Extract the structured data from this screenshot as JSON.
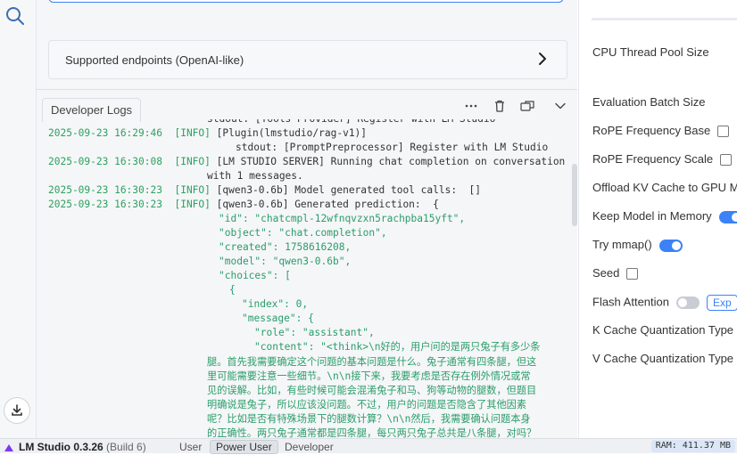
{
  "endpoint": {
    "label": "Supported endpoints (OpenAI-like)"
  },
  "logs_panel": {
    "tab_label": "Developer Logs"
  },
  "log_lines": {
    "l0": "stdout: [Tools Provider] Register with LM Studio",
    "l1_ts": "2025-09-23 16:29:46",
    "l1_lvl": "[INFO]",
    "l1_msg": "[Plugin(lmstudio/rag-v1)]",
    "l2": "stdout: [PromptPreprocessor] Register with LM Studio",
    "l3_ts": "2025-09-23 16:30:08",
    "l3_lvl": "[INFO]",
    "l3_msg": "[LM STUDIO SERVER] Running chat completion on conversation",
    "l4": "with 1 messages.",
    "l5_ts": "2025-09-23 16:30:23",
    "l5_lvl": "[INFO]",
    "l5_msg": "[qwen3-0.6b] Model generated tool calls:  []",
    "l6_ts": "2025-09-23 16:30:23",
    "l6_lvl": "[INFO]",
    "l6_msg": "[qwen3-0.6b] Generated prediction:  {",
    "j1": "\"id\": \"chatcmpl-12wfnqvzxn5rachpba15yft\",",
    "j2": "\"object\": \"chat.completion\",",
    "j3": "\"created\": 1758616208,",
    "j4": "\"model\": \"qwen3-0.6b\",",
    "j5": "\"choices\": [",
    "j6": "{",
    "j7": "\"index\": 0,",
    "j8": "\"message\": {",
    "j9": "\"role\": \"assistant\",",
    "j10": "\"content\": \"<think>\\n好的，用户问的是两只兔子有多少条",
    "c1": "腿。首先我需要确定这个问题的基本问题是什么。兔子通常有四条腿，但这",
    "c2": "里可能需要注意一些细节。\\n\\n接下来，我要考虑是否存在例外情况或常",
    "c3": "见的误解。比如，有些时候可能会混淆兔子和马、狗等动物的腿数，但题目",
    "c4": "明确说是兔子，所以应该没问题。不过，用户的问题是否隐含了其他因素",
    "c5": "呢？比如是否有特殊场景下的腿数计算？\\n\\n然后，我需要确认问题本身",
    "c6": "的正确性。两只兔子通常都是四条腿，每只两只兔子总共是八条腿，对吗？"
  },
  "settings": {
    "cpu_thread": "CPU Thread Pool Size",
    "eval_batch": "Evaluation Batch Size",
    "rope_base": "RoPE Frequency Base",
    "rope_scale": "RoPE Frequency Scale",
    "offload_kv": "Offload KV Cache to GPU M",
    "keep_model": "Keep Model in Memory",
    "mmap": "Try mmap()",
    "seed": "Seed",
    "flash": "Flash Attention",
    "exp": "Exp",
    "k_cache": "K Cache Quantization Type",
    "v_cache": "V Cache Quantization Type"
  },
  "settings_state": {
    "rope_base_checked": false,
    "rope_scale_checked": false,
    "keep_model_on": true,
    "mmap_on": true,
    "seed_checked": false,
    "flash_on": false
  },
  "statusbar": {
    "app_name": "LM Studio 0.3.26",
    "build": "(Build 6)",
    "modes": [
      "User",
      "Power User",
      "Developer"
    ],
    "active_mode": "Power User",
    "ram": "RAM: 411.37 MB"
  },
  "colors": {
    "accent": "#3b82f6",
    "log_green": "#2ca25f",
    "ram_badge": "#dbe6f7"
  }
}
